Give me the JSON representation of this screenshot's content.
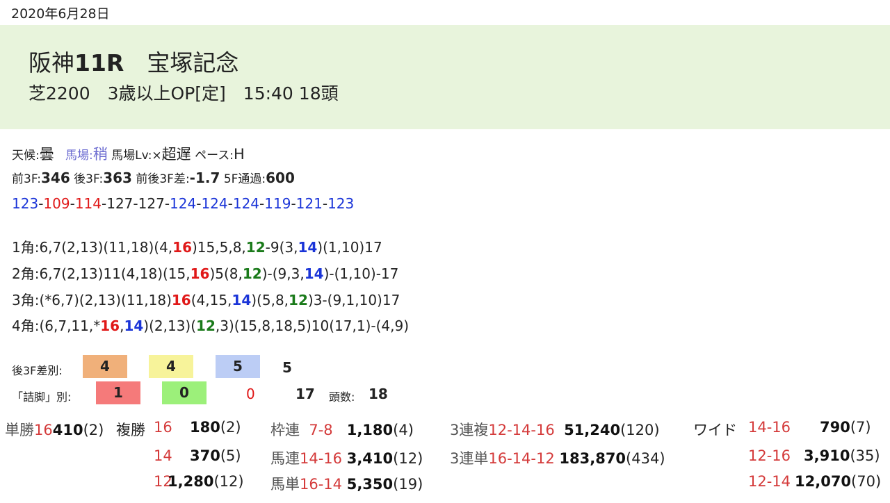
{
  "date": "2020年6月28日",
  "header": {
    "venue_race": "阪神",
    "race_no": "11R",
    "race_name": "宝塚記念",
    "conditions": "芝2200　3歳以上OP[定]　15:40 18頭"
  },
  "track": {
    "weather_label": "天候:",
    "weather": "曇",
    "baba_label": "馬場:",
    "baba": "稍",
    "baba_lv_label": "馬場Lv:×",
    "baba_lv": "超遅",
    "pace_label": "ペース:",
    "pace": "H"
  },
  "times": {
    "f3_label": "前3F:",
    "f3": "346",
    "l3_label": "後3F:",
    "l3": "363",
    "diff_label": "前後3F差:",
    "diff": "-1.7",
    "f5_label": "5F通過:",
    "f5": "600"
  },
  "laps": [
    {
      "v": "123",
      "c": "blue"
    },
    {
      "v": "109",
      "c": "red"
    },
    {
      "v": "114",
      "c": "red"
    },
    {
      "v": "127",
      "c": "dark"
    },
    {
      "v": "127",
      "c": "dark"
    },
    {
      "v": "124",
      "c": "blue"
    },
    {
      "v": "124",
      "c": "blue"
    },
    {
      "v": "124",
      "c": "blue"
    },
    {
      "v": "119",
      "c": "blue"
    },
    {
      "v": "121",
      "c": "blue"
    },
    {
      "v": "123",
      "c": "blue"
    }
  ],
  "corners": [
    [
      {
        "t": "1角:6,7(2,13)(11,18)(4,"
      },
      {
        "t": "16",
        "c": "red"
      },
      {
        "t": ")15,5,8,"
      },
      {
        "t": "12",
        "c": "green"
      },
      {
        "t": "-9(3,"
      },
      {
        "t": "14",
        "c": "blue"
      },
      {
        "t": ")(1,10)17"
      }
    ],
    [
      {
        "t": "2角:6,7(2,13)11(4,18)(15,"
      },
      {
        "t": "16",
        "c": "red"
      },
      {
        "t": ")5(8,"
      },
      {
        "t": "12",
        "c": "green"
      },
      {
        "t": ")-(9,3,"
      },
      {
        "t": "14",
        "c": "blue"
      },
      {
        "t": ")-(1,10)-17"
      }
    ],
    [
      {
        "t": "3角:(*6,7)(2,13)(11,18)"
      },
      {
        "t": "16",
        "c": "red"
      },
      {
        "t": "(4,15,"
      },
      {
        "t": "14",
        "c": "blue"
      },
      {
        "t": ")(5,8,"
      },
      {
        "t": "12",
        "c": "green"
      },
      {
        "t": ")3-(9,1,10)17"
      }
    ],
    [
      {
        "t": "4角:(6,7,11,*"
      },
      {
        "t": "16",
        "c": "red"
      },
      {
        "t": ","
      },
      {
        "t": "14",
        "c": "blue"
      },
      {
        "t": ")(2,13)("
      },
      {
        "t": "12",
        "c": "green"
      },
      {
        "t": ",3)(15,8,18,5)10(17,1)-(4,9)"
      }
    ]
  ],
  "stats": {
    "l3_diff_label": "後3F差別:",
    "l3_diff": [
      "4",
      "4",
      "5",
      "5"
    ],
    "tsume_label": "「詰脚」別:",
    "tsume": [
      "1",
      "0",
      "0",
      "17"
    ],
    "heads_label": "頭数:",
    "heads": "18",
    "colors": {
      "orange": "#f0b07a",
      "yellow": "#f7f39a",
      "blue": "#bccdf5",
      "red": "#f57a7a",
      "green": "#9cf07a"
    }
  },
  "payouts": {
    "tansho": {
      "label": "単勝",
      "combo": "16",
      "amount": "410",
      "pop": "(2)"
    },
    "fukusho": {
      "label": "複勝",
      "rows": [
        {
          "combo": "16",
          "amount": "180",
          "pop": "(2)"
        },
        {
          "combo": "14",
          "amount": "370",
          "pop": "(5)"
        },
        {
          "combo": "12",
          "amount": "1,280",
          "pop": "(12)"
        }
      ]
    },
    "wakuren": {
      "label": "枠連",
      "combo": "7-8",
      "amount": "1,180",
      "pop": "(4)"
    },
    "umaren": {
      "label": "馬連",
      "combo": "14-16",
      "amount": "3,410",
      "pop": "(12)"
    },
    "umatan": {
      "label": "馬単",
      "combo": "16-14",
      "amount": "5,350",
      "pop": "(19)"
    },
    "sanrenpuku": {
      "label": "3連複",
      "combo": "12-14-16",
      "amount": "51,240",
      "pop": "(120)"
    },
    "sanrentan": {
      "label": "3連単",
      "combo": "16-14-12",
      "amount": "183,870",
      "pop": "(434)"
    },
    "wide": {
      "label": "ワイド",
      "rows": [
        {
          "combo": "14-16",
          "amount": "790",
          "pop": "(7)"
        },
        {
          "combo": "12-16",
          "amount": "3,910",
          "pop": "(35)"
        },
        {
          "combo": "12-14",
          "amount": "12,070",
          "pop": "(70)"
        }
      ]
    }
  }
}
